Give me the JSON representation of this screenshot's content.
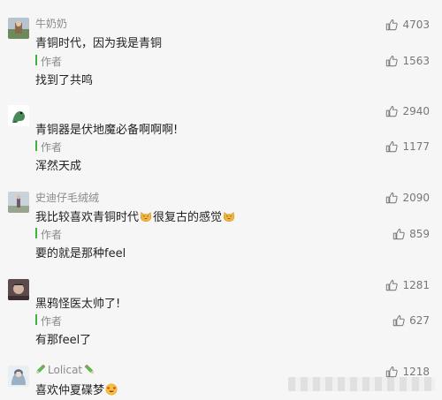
{
  "comments": [
    {
      "name": "牛奶奶",
      "text": "青铜时代，因为我是青铜",
      "likes": "4703",
      "reply": {
        "author_label": "作者",
        "text": "找到了共鸣",
        "likes": "1563"
      }
    },
    {
      "name": "",
      "text": "青铜器是伏地魔必备啊啊啊!",
      "likes": "2940",
      "reply": {
        "author_label": "作者",
        "text": "浑然天成",
        "likes": "1177"
      }
    },
    {
      "name": "史迪仔毛绒绒",
      "text_before": "我比较喜欢青铜时代",
      "text_after": "很复古的感觉",
      "likes": "2090",
      "reply": {
        "author_label": "作者",
        "text": "要的就是那种feel",
        "likes": "859"
      }
    },
    {
      "name": "",
      "text": "黑鸦怪医太帅了!",
      "likes": "1281",
      "reply": {
        "author_label": "作者",
        "text": "有那feel了",
        "likes": "627"
      }
    },
    {
      "name": "Lolicat",
      "text": "喜欢仲夏碟梦",
      "likes": "1218"
    }
  ],
  "colors": {
    "author_bar": "#3fb33f",
    "background": "#f6f6f6"
  },
  "icons": {
    "like": "thumbs-up-icon",
    "cat": "cat-face-emoji",
    "heart_eyes": "heart-eyes-emoji",
    "pencil": "pencil-emoji"
  }
}
